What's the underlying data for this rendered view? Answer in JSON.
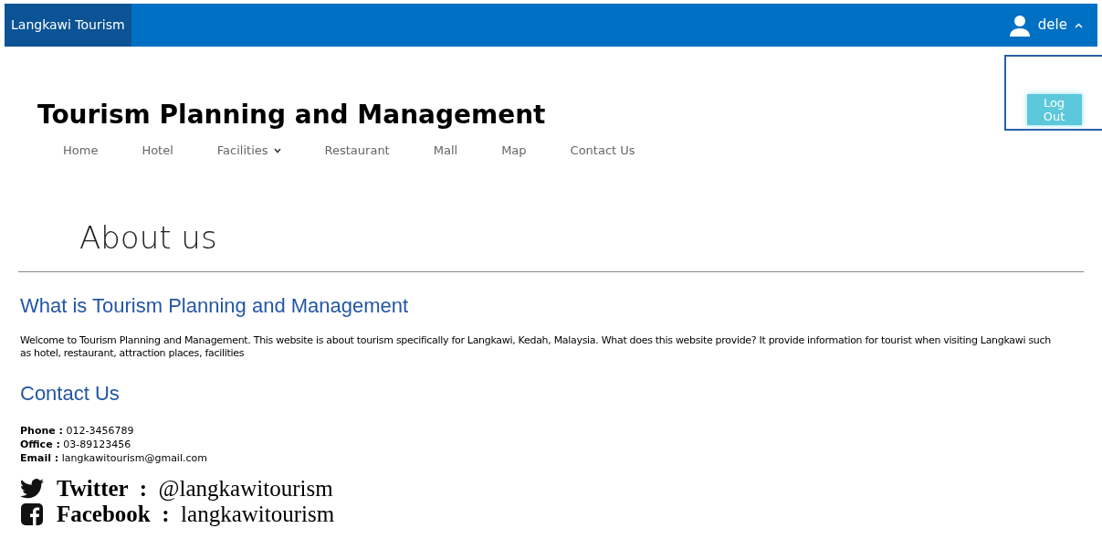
{
  "navbar": {
    "brand": "Langkawi Tourism",
    "user": {
      "name": "dele",
      "expanded": true
    },
    "user_menu": {
      "button": "Log Out"
    }
  },
  "site_title": "Tourism Planning and Management",
  "nav": [
    {
      "label": "Home",
      "has_dropdown": false
    },
    {
      "label": "Hotel",
      "has_dropdown": false
    },
    {
      "label": "Facilities",
      "has_dropdown": true
    },
    {
      "label": "Restaurant",
      "has_dropdown": false
    },
    {
      "label": "Mall",
      "has_dropdown": false
    },
    {
      "label": "Map",
      "has_dropdown": false
    },
    {
      "label": "Contact Us",
      "has_dropdown": false
    }
  ],
  "page_heading": "About us",
  "sections": [
    {
      "heading": "What is Tourism Planning and Management",
      "body": "Welcome to Tourism Planning and Management. This website is about tourism specifically for Langkawi, Kedah, Malaysia. What does this website provide? It provide information for tourist when visiting Langkawi such as hotel, restaurant, attraction places, facilities"
    },
    {
      "heading": "Contact Us",
      "contacts": [
        "**Phone :** 012-3456789",
        "**Office :** 03-89123456",
        "**Email :** langkawitourism@gmail.com"
      ],
      "social": [
        {
          "kind": "twitter",
          "text": "**Twitter  :**  @langkawitourism"
        },
        {
          "kind": "facebook",
          "text": "**Facebook  :**  langkawitourism"
        }
      ]
    }
  ]
}
